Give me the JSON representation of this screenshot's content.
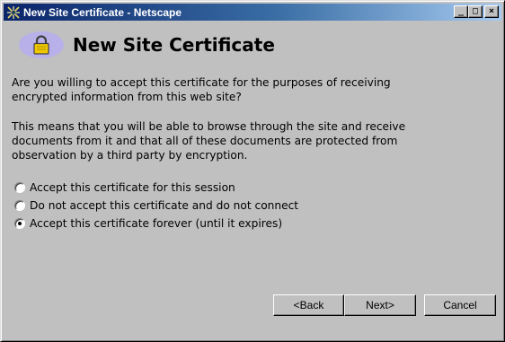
{
  "window": {
    "title": "New Site Certificate - Netscape",
    "controls": {
      "minimize": "_",
      "maximize": "□",
      "close": "×"
    }
  },
  "header": {
    "title": "New Site Certificate",
    "icon": "lock-icon"
  },
  "body": {
    "question": "Are you willing to accept this certificate for the purposes of receiving\nencrypted information from this web site?",
    "explanation": "This means that you will be able to browse through the site and receive\ndocuments from it and that all of these documents are protected from\nobservation by a third party by encryption."
  },
  "options": [
    {
      "label": "Accept this certificate for this session",
      "selected": false
    },
    {
      "label": "Do not accept this certificate and do not connect",
      "selected": false
    },
    {
      "label": "Accept this certificate forever (until it expires)",
      "selected": true
    }
  ],
  "buttons": {
    "back": "<Back",
    "next": "Next>",
    "cancel": "Cancel"
  },
  "colors": {
    "titlebar_start": "#0a246a",
    "titlebar_end": "#a6caf0",
    "face": "#c0c0c0",
    "lock_badge": "#b8b0e8",
    "lock_body": "#f0c800"
  }
}
